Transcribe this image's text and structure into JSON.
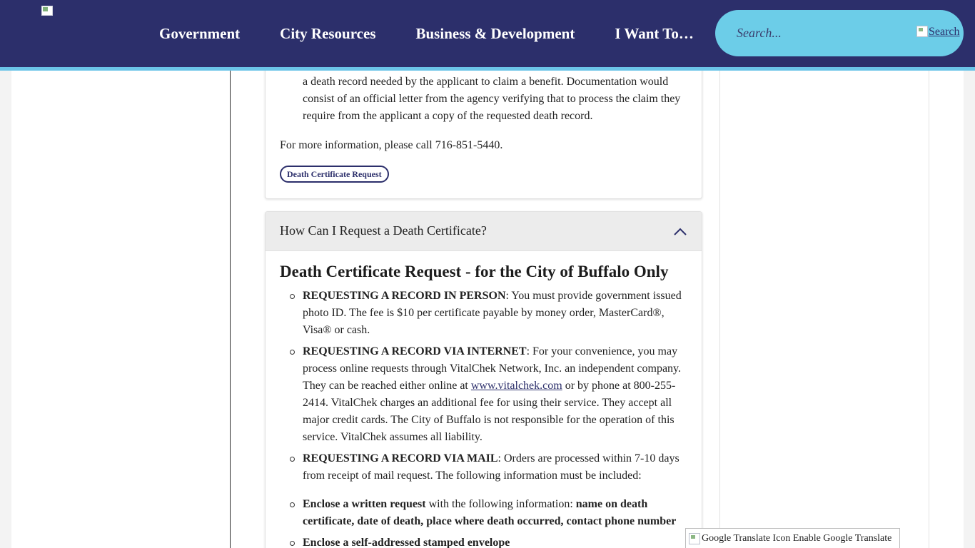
{
  "header": {
    "nav": [
      "Government",
      "City Resources",
      "Business & Development",
      "I Want To…"
    ],
    "search": {
      "placeholder": "Search...",
      "button_label": "Search"
    }
  },
  "prev_panel": {
    "list_continuation": "a death record needed by the applicant to claim a benefit. Documentation would consist of an official letter from the agency verifying that to process the claim they require from the applicant a copy of the requested death record.",
    "more_info": "For more information, please call 716-851-5440.",
    "pill_label": "Death Certificate Request"
  },
  "accordion": {
    "title": "How Can I Request a Death Certificate?",
    "expanded": true,
    "section_title": "Death Certificate Request - for the City of Buffalo Only",
    "items": [
      {
        "bold": "REQUESTING A RECORD IN PERSON",
        "text": ": You must provide government issued photo ID.  The fee is $10 per certificate payable by money order, MasterCard®, Visa® or cash."
      },
      {
        "bold": "REQUESTING A RECORD VIA INTERNET",
        "text_before": ": For your convenience, you may process online requests through VitalChek Network, Inc. an independent company. They can be reached either online at ",
        "link": "www.vitalchek.com",
        "text_after": " or by phone at 800-255-2414. VitalChek charges an additional fee for using their service. They accept all major credit cards. The City of Buffalo is not responsible for the operation of this service. VitalChek assumes all liability."
      },
      {
        "bold": "REQUESTING A RECORD VIA MAIL",
        "text": ": Orders are processed within 7-10 days from receipt of mail request.  The following information must be included:"
      },
      {
        "bold": "Enclose a written request",
        "text": " with the following information: ",
        "bold_after": "name on death certificate, date of death, place where death occurred, contact phone number"
      },
      {
        "bold": "Enclose a self-addressed stamped envelope"
      }
    ]
  },
  "translate": {
    "label": "Google Translate Icon Enable Google Translate"
  },
  "colors": {
    "header_bg": "#2c2f6b",
    "accent": "#6bc4e8",
    "search_bg": "#6ccde8"
  },
  "icons": [
    "logo-image",
    "search-icon",
    "chevron-up-icon",
    "google-translate-icon"
  ]
}
